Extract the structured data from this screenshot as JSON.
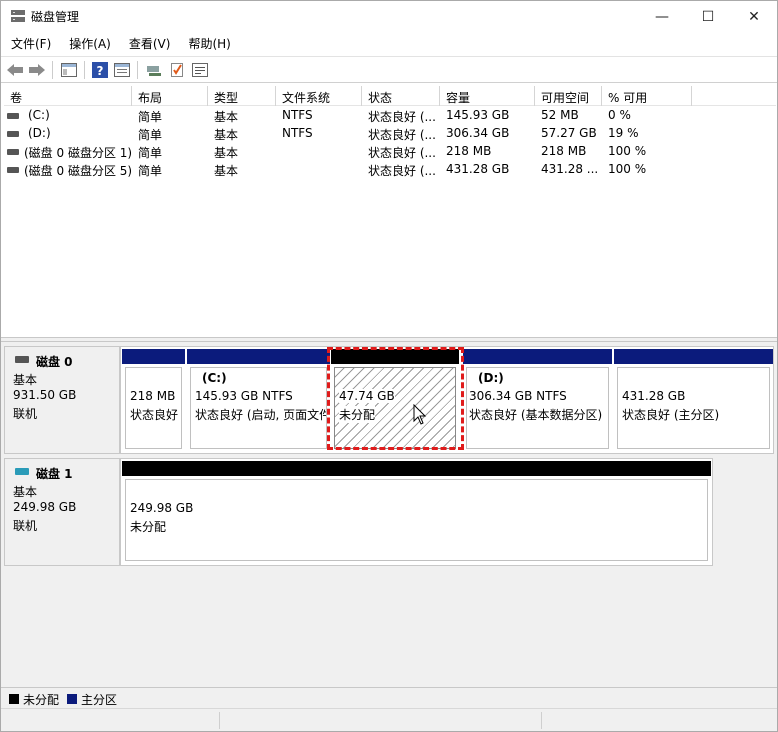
{
  "window": {
    "title": "磁盘管理",
    "minimize": "—",
    "maximize": "☐",
    "close": "✕"
  },
  "menu": [
    "文件(F)",
    "操作(A)",
    "查看(V)",
    "帮助(H)"
  ],
  "toolbar": {
    "icons": [
      "back-icon",
      "forward-icon",
      "console-tree-icon",
      "help-icon",
      "properties-icon",
      "connect-icon",
      "check-icon",
      "list-icon"
    ]
  },
  "volume_table": {
    "headers": [
      "卷",
      "布局",
      "类型",
      "文件系统",
      "状态",
      "容量",
      "可用空间",
      "% 可用"
    ],
    "rows": [
      [
        "(C:)",
        "简单",
        "基本",
        "NTFS",
        "状态良好 (...",
        "145.93 GB",
        "52 MB",
        "0 %"
      ],
      [
        "(D:)",
        "简单",
        "基本",
        "NTFS",
        "状态良好 (...",
        "306.34 GB",
        "57.27 GB",
        "19 %"
      ],
      [
        "(磁盘 0 磁盘分区 1)",
        "简单",
        "基本",
        "",
        "状态良好 (...",
        "218 MB",
        "218 MB",
        "100 %"
      ],
      [
        "(磁盘 0 磁盘分区 5)",
        "简单",
        "基本",
        "",
        "状态良好 (...",
        "431.28 GB",
        "431.28 ...",
        "100 %"
      ]
    ]
  },
  "disks": [
    {
      "name": "磁盘 0",
      "type": "基本",
      "size": "931.50 GB",
      "status": "联机",
      "partitions": [
        {
          "label": "",
          "size": "218 MB",
          "status": "状态良好",
          "kind": "primary"
        },
        {
          "label": "(C:)",
          "size": "145.93 GB NTFS",
          "status": "状态良好 (启动, 页面文件",
          "kind": "primary"
        },
        {
          "label": "",
          "size": "47.74 GB",
          "status": "未分配",
          "kind": "unallocated"
        },
        {
          "label": "(D:)",
          "size": "306.34 GB NTFS",
          "status": "状态良好 (基本数据分区)",
          "kind": "primary"
        },
        {
          "label": "",
          "size": "431.28 GB",
          "status": "状态良好 (主分区)",
          "kind": "primary"
        }
      ]
    },
    {
      "name": "磁盘 1",
      "type": "基本",
      "size": "249.98 GB",
      "status": "联机",
      "partitions": [
        {
          "label": "",
          "size": "249.98 GB",
          "status": "未分配",
          "kind": "unallocated"
        }
      ]
    }
  ],
  "legend": [
    {
      "label": "未分配",
      "color": "#000000"
    },
    {
      "label": "主分区",
      "color": "#0b1b7c"
    }
  ],
  "colors": {
    "primary_bar": "#0b1b7c",
    "unallocated_bar": "#000000",
    "highlight": "#e01b1b"
  }
}
